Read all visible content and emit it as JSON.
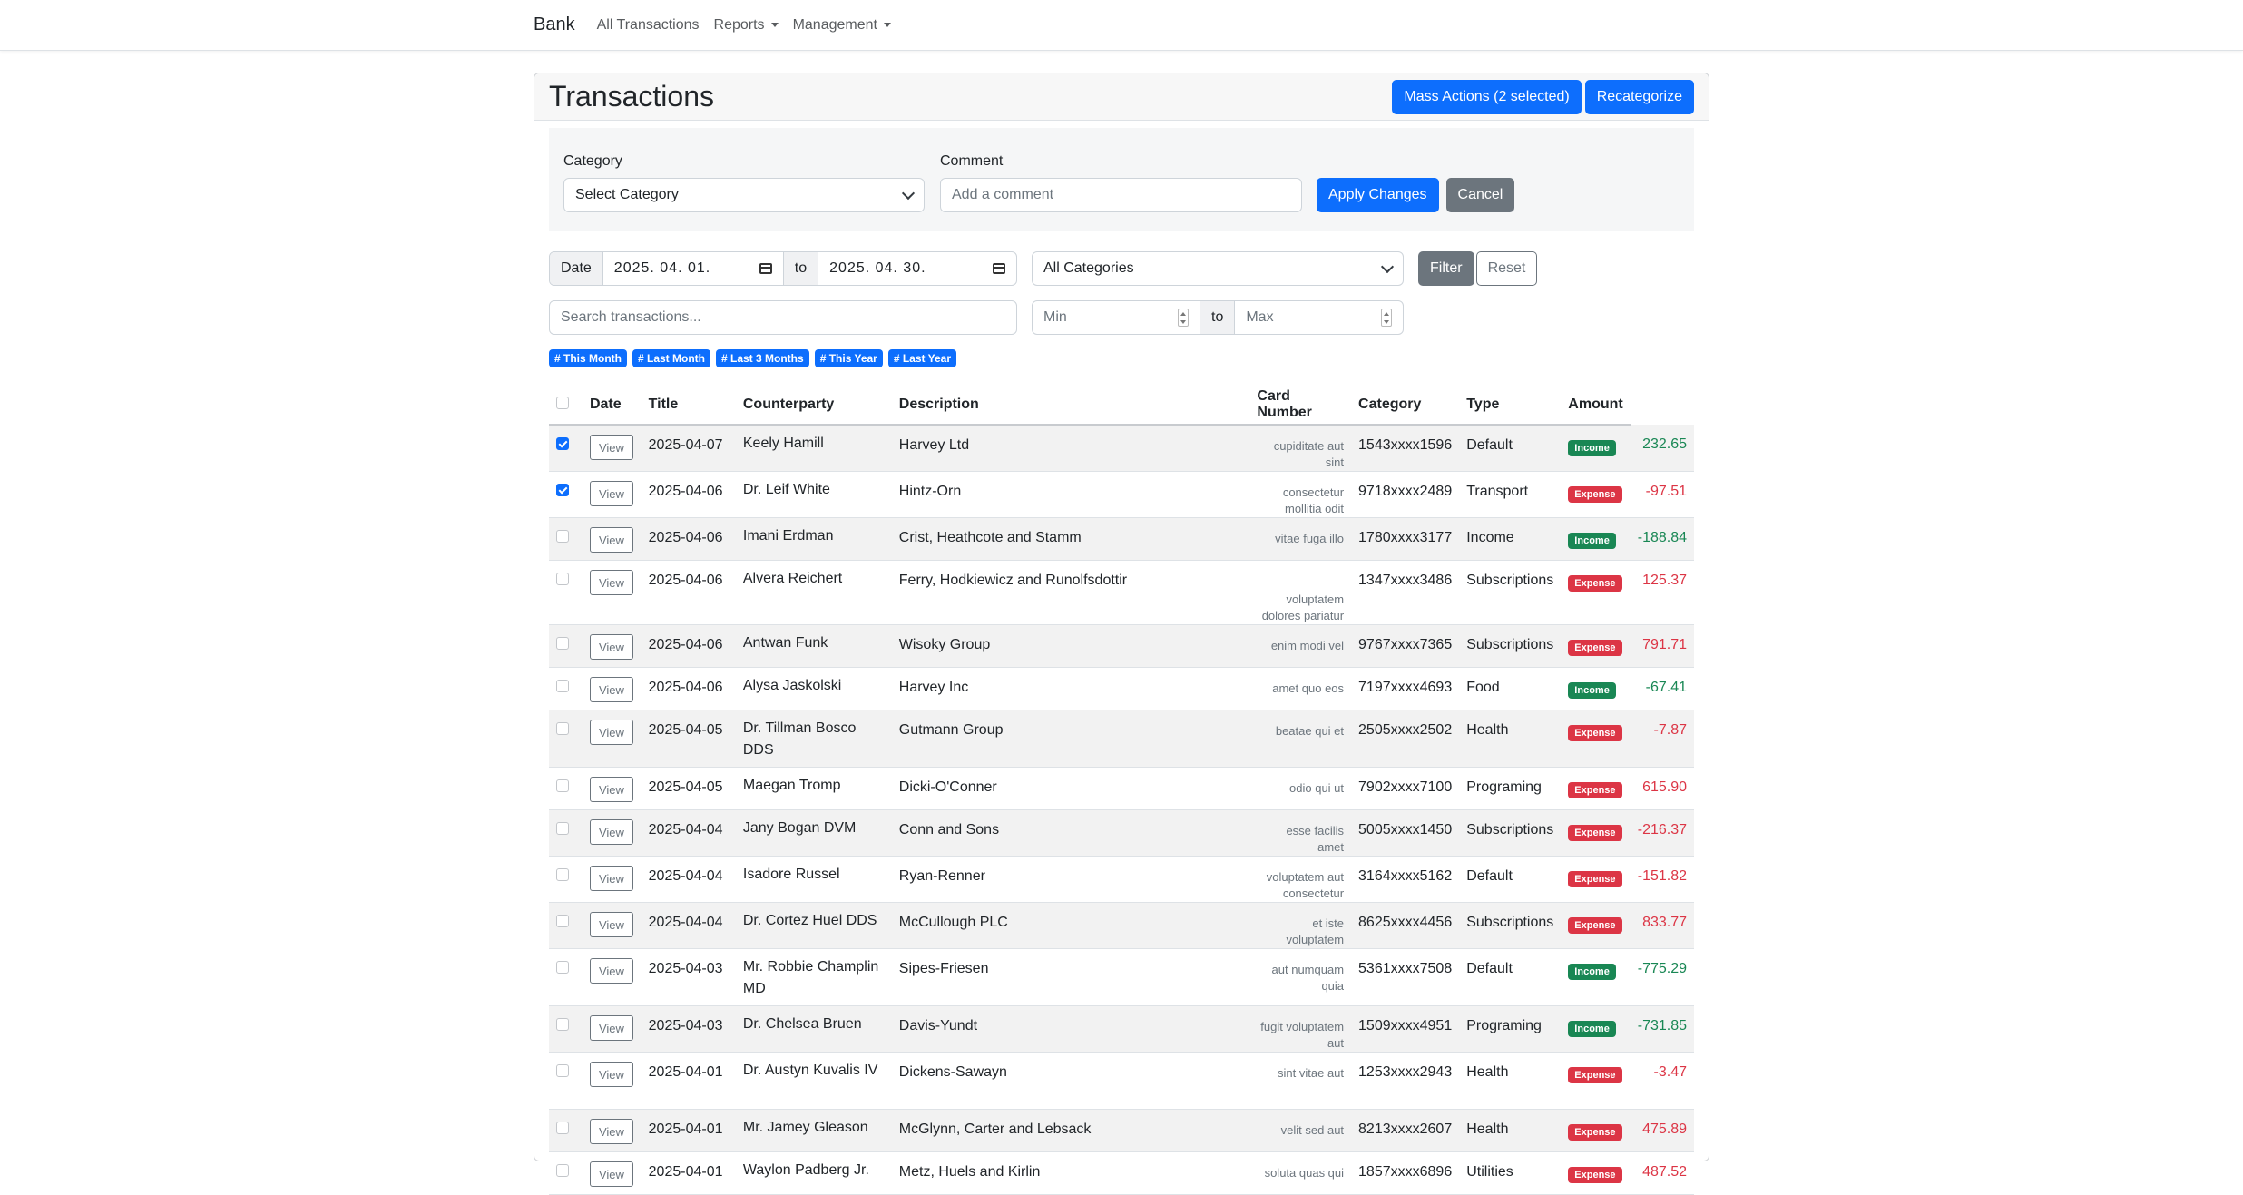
{
  "nav": {
    "brand": "Bank",
    "links": [
      {
        "label": "All Transactions",
        "dropdown": false
      },
      {
        "label": "Reports",
        "dropdown": true
      },
      {
        "label": "Management",
        "dropdown": true
      }
    ]
  },
  "header": {
    "title": "Transactions",
    "mass_actions_label": "Mass Actions (2 selected)",
    "recategorize_label": "Recategorize"
  },
  "mass_panel": {
    "category_label": "Category",
    "category_value": "Select Category",
    "comment_label": "Comment",
    "comment_placeholder": "Add a comment",
    "apply_label": "Apply Changes",
    "cancel_label": "Cancel"
  },
  "filters": {
    "date_label": "Date",
    "date_from": "2025. 04. 01.",
    "to_label": "to",
    "date_to": "2025. 04. 30.",
    "category_value": "All Categories",
    "filter_label": "Filter",
    "reset_label": "Reset",
    "search_placeholder": "Search transactions...",
    "min_placeholder": "Min",
    "max_placeholder": "Max",
    "presets": [
      "# This Month",
      "# Last Month",
      "# Last 3 Months",
      "# This Year",
      "# Last Year"
    ]
  },
  "colors": {
    "primary": "#0d6efd",
    "income": "#198754",
    "expense": "#dc3545"
  },
  "table": {
    "columns": [
      "Date",
      "Title",
      "Counterparty",
      "Description",
      "Card Number",
      "Category",
      "Type",
      "Amount"
    ],
    "view_label": "View",
    "rows": [
      {
        "checked": true,
        "date": "2025-04-07",
        "title": "Keely Hamill",
        "counterparty": "Harvey Ltd",
        "note": "cupiditate aut sint",
        "card": "1543xxxx1596",
        "category": "Default",
        "type": "Income",
        "amount": "232.65"
      },
      {
        "checked": true,
        "date": "2025-04-06",
        "title": "Dr. Leif White",
        "counterparty": "Hintz-Orn",
        "note": "consectetur mollitia odit",
        "card": "9718xxxx2489",
        "category": "Transport",
        "type": "Expense",
        "amount": "-97.51"
      },
      {
        "checked": false,
        "date": "2025-04-06",
        "title": "Imani Erdman",
        "counterparty": "Crist, Heathcote and Stamm",
        "note": "vitae fuga illo",
        "card": "1780xxxx3177",
        "category": "Income",
        "type": "Income",
        "amount": "-188.84"
      },
      {
        "checked": false,
        "date": "2025-04-06",
        "title": "Alvera Reichert",
        "counterparty": "Ferry, Hodkiewicz and Runolfsdottir",
        "note": "voluptatem dolores pariatur",
        "card": "1347xxxx3486",
        "category": "Subscriptions",
        "type": "Expense",
        "amount": "125.37"
      },
      {
        "checked": false,
        "date": "2025-04-06",
        "title": "Antwan Funk",
        "counterparty": "Wisoky Group",
        "note": "enim modi vel",
        "card": "9767xxxx7365",
        "category": "Subscriptions",
        "type": "Expense",
        "amount": "791.71"
      },
      {
        "checked": false,
        "date": "2025-04-06",
        "title": "Alysa Jaskolski",
        "counterparty": "Harvey Inc",
        "note": "amet quo eos",
        "card": "7197xxxx4693",
        "category": "Food",
        "type": "Income",
        "amount": "-67.41"
      },
      {
        "checked": false,
        "date": "2025-04-05",
        "title": "Dr. Tillman Bosco DDS",
        "counterparty": "Gutmann Group",
        "note": "beatae qui et",
        "card": "2505xxxx2502",
        "category": "Health",
        "type": "Expense",
        "amount": "-7.87"
      },
      {
        "checked": false,
        "date": "2025-04-05",
        "title": "Maegan Tromp",
        "counterparty": "Dicki-O'Conner",
        "note": "odio qui ut",
        "card": "7902xxxx7100",
        "category": "Programing",
        "type": "Expense",
        "amount": "615.90"
      },
      {
        "checked": false,
        "date": "2025-04-04",
        "title": "Jany Bogan DVM",
        "counterparty": "Conn and Sons",
        "note": "esse facilis amet",
        "card": "5005xxxx1450",
        "category": "Subscriptions",
        "type": "Expense",
        "amount": "-216.37"
      },
      {
        "checked": false,
        "date": "2025-04-04",
        "title": "Isadore Russel",
        "counterparty": "Ryan-Renner",
        "note": "voluptatem aut consectetur",
        "card": "3164xxxx5162",
        "category": "Default",
        "type": "Expense",
        "amount": "-151.82"
      },
      {
        "checked": false,
        "date": "2025-04-04",
        "title": "Dr. Cortez Huel DDS",
        "counterparty": "McCullough PLC",
        "note": "et iste voluptatem",
        "card": "8625xxxx4456",
        "category": "Subscriptions",
        "type": "Expense",
        "amount": "833.77"
      },
      {
        "checked": false,
        "date": "2025-04-03",
        "title": "Mr. Robbie Champlin MD",
        "counterparty": "Sipes-Friesen",
        "note": "aut numquam quia",
        "card": "5361xxxx7508",
        "category": "Default",
        "type": "Income",
        "amount": "-775.29"
      },
      {
        "checked": false,
        "date": "2025-04-03",
        "title": "Dr. Chelsea Bruen",
        "counterparty": "Davis-Yundt",
        "note": "fugit voluptatem aut",
        "card": "1509xxxx4951",
        "category": "Programing",
        "type": "Income",
        "amount": "-731.85"
      },
      {
        "checked": false,
        "date": "2025-04-01",
        "title": "Dr. Austyn Kuvalis IV",
        "counterparty": "Dickens-Sawayn",
        "note": "sint vitae aut",
        "card": "1253xxxx2943",
        "category": "Health",
        "type": "Expense",
        "amount": "-3.47"
      },
      {
        "checked": false,
        "date": "2025-04-01",
        "title": "Mr. Jamey Gleason",
        "counterparty": "McGlynn, Carter and Lebsack",
        "note": "velit sed aut",
        "card": "8213xxxx2607",
        "category": "Health",
        "type": "Expense",
        "amount": "475.89"
      },
      {
        "checked": false,
        "date": "2025-04-01",
        "title": "Waylon Padberg Jr.",
        "counterparty": "Metz, Huels and Kirlin",
        "note": "soluta quas qui",
        "card": "1857xxxx6896",
        "category": "Utilities",
        "type": "Expense",
        "amount": "487.52"
      }
    ]
  }
}
